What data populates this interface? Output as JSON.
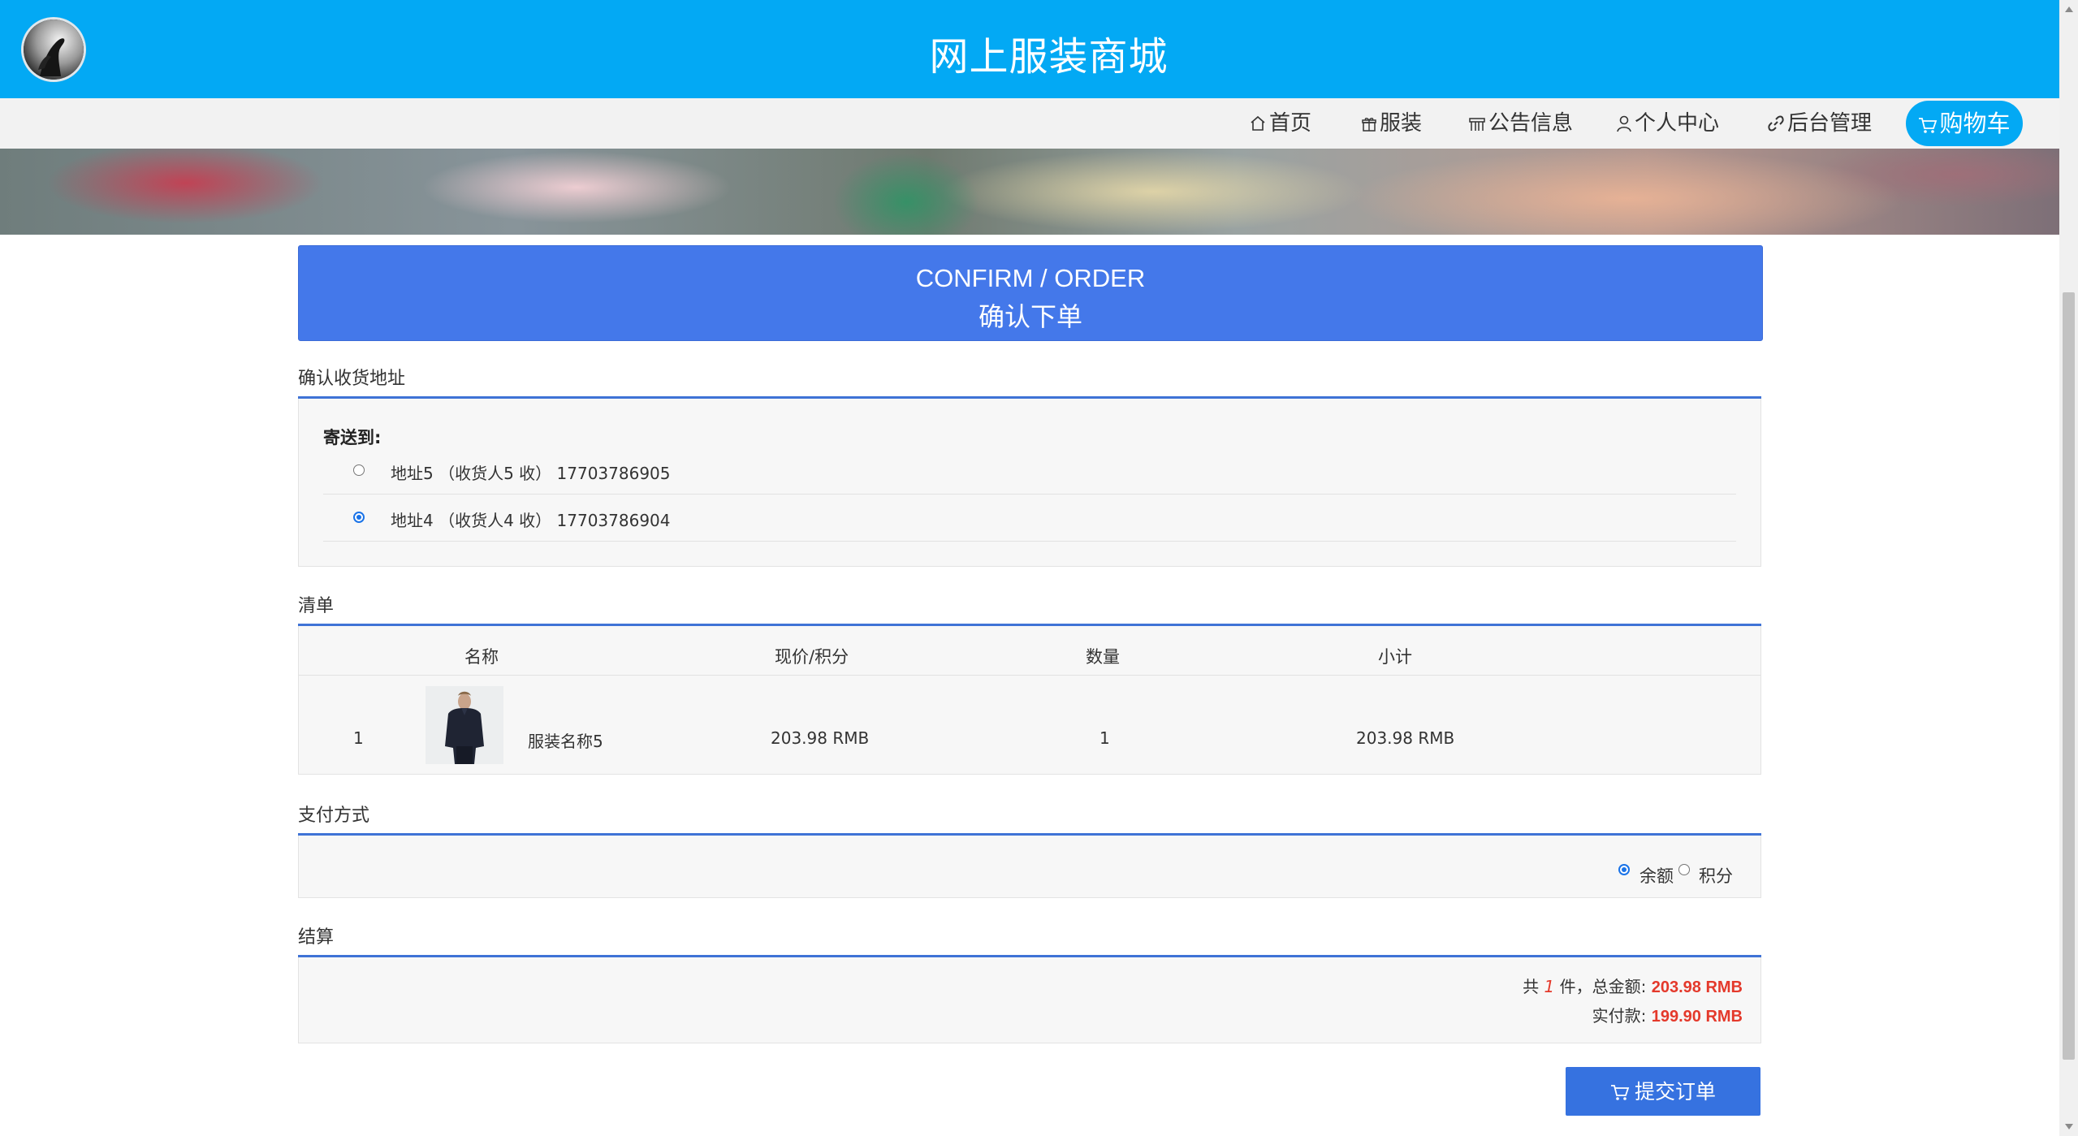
{
  "header": {
    "site_title": "网上服装商城"
  },
  "nav": {
    "items": [
      {
        "label": "首页",
        "icon": "home-icon"
      },
      {
        "label": "服装",
        "icon": "gift-icon"
      },
      {
        "label": "公告信息",
        "icon": "notice-icon"
      },
      {
        "label": "个人中心",
        "icon": "user-icon"
      },
      {
        "label": "后台管理",
        "icon": "link-icon"
      }
    ],
    "cart_label": "购物车",
    "accent_color": "#03a9f4"
  },
  "heading": {
    "en": "CONFIRM / ORDER",
    "zh": "确认下单"
  },
  "address": {
    "section_title": "确认收货地址",
    "ship_to_label": "寄送到:",
    "options": [
      {
        "text": "地址5 （收货人5 收） 17703786905",
        "selected": false
      },
      {
        "text": "地址4 （收货人4 收） 17703786904",
        "selected": true
      }
    ]
  },
  "order_list": {
    "section_title": "清单",
    "headers": {
      "name": "名称",
      "price": "现价/积分",
      "quantity": "数量",
      "subtotal": "小计"
    },
    "rows": [
      {
        "index": "1",
        "name": "服装名称5",
        "price": "203.98 RMB",
        "quantity": "1",
        "subtotal": "203.98 RMB"
      }
    ]
  },
  "payment": {
    "section_title": "支付方式",
    "options": [
      {
        "label": "余额",
        "selected": true
      },
      {
        "label": "积分",
        "selected": false
      }
    ]
  },
  "settlement": {
    "section_title": "结算",
    "count_prefix": "共",
    "count": "1",
    "count_suffix": "件，总金额:",
    "total": "203.98 RMB",
    "actual_label": "实付款:",
    "actual": "199.90 RMB"
  },
  "submit_label": "提交订单",
  "colors": {
    "primary": "#4478ea",
    "price_red": "#e4392b"
  }
}
